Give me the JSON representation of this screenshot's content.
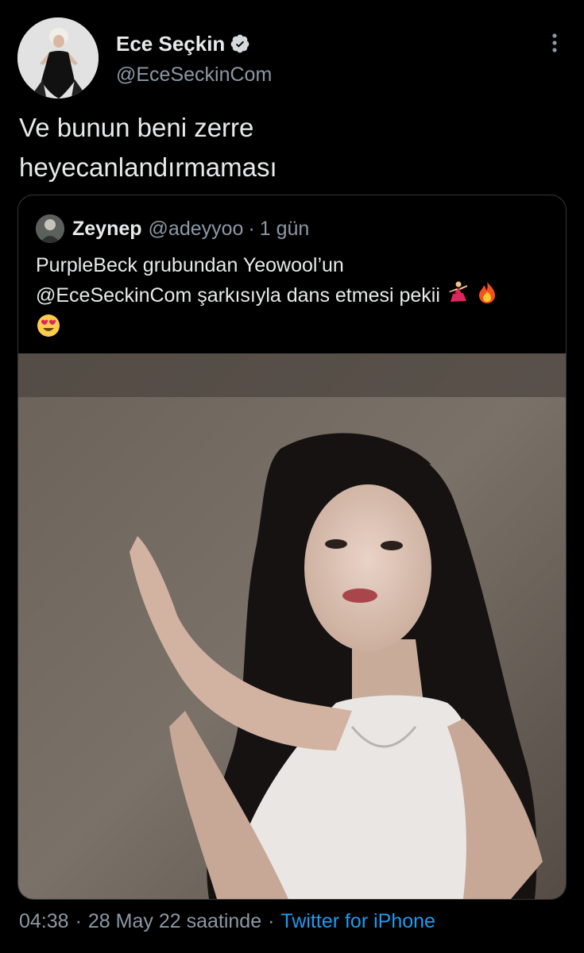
{
  "author": {
    "display_name": "Ece Seçkin",
    "handle": "@EceSeckinCom",
    "verified": true,
    "avatar_icon": "profile-photo"
  },
  "more_icon": "more-vertical-icon",
  "tweet": {
    "text_lines": [
      "Ve bunun beni zerre",
      "heyecanlandırmaması"
    ]
  },
  "quote": {
    "display_name": "Zeynep",
    "handle": "@adeyyoo",
    "separator": "·",
    "time": "1 gün",
    "text_line1": "PurpleBeck grubundan Yeowool’un",
    "text_line2": "@EceSeckinCom şarkısıyla dans etmesi pekii",
    "emojis": [
      "dancer-emoji",
      "fire-emoji",
      "heart-eyes-emoji"
    ],
    "media": "video-thumbnail"
  },
  "footer": {
    "time": "04:38",
    "separator": "·",
    "date": "28 May 22 saatinde",
    "source": "Twitter for iPhone"
  },
  "colors": {
    "background": "#000000",
    "text": "#e7e9ea",
    "secondary_text": "#8b98a5",
    "link": "#1d9bf0",
    "border": "#333639",
    "verified": "#d6d9db"
  }
}
